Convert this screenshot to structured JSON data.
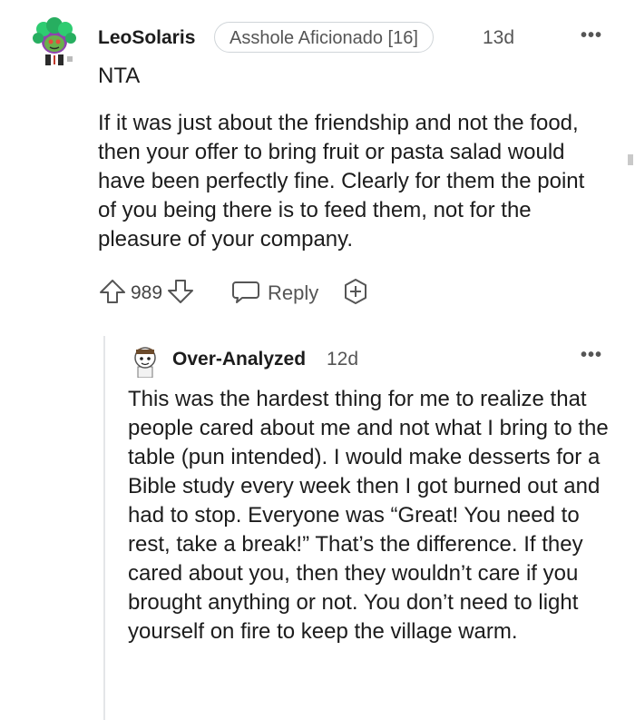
{
  "comment": {
    "author": "LeoSolaris",
    "flair": "Asshole Aficionado [16]",
    "age": "13d",
    "more": "•••",
    "verdict": "NTA",
    "body": "If it was just about the friendship and not the food, then your offer to bring fruit or pasta salad would have been perfectly fine. Clearly for them the point of you being there is to feed them, not for the pleasure of your company.",
    "score": "989",
    "reply_label": "Reply",
    "avatar_icon": "snoo-avatar-icon"
  },
  "reply": {
    "author": "Over-Analyzed",
    "age": "12d",
    "more": "•••",
    "body": "This was the hardest thing for me to realize that people cared about me and not what I bring to the table (pun intended). I would make desserts for a Bible study every week then I got burned out and had to stop. Everyone was “Great! You need to rest, take a break!” That’s the difference. If they cared about you, then they wouldn’t care if you brought anything or not. You don’t need to light yourself on fire to keep the village warm.",
    "avatar_icon": "snoo-avatar-icon"
  },
  "colors": {
    "text": "#1c1c1c",
    "muted": "#555555",
    "border": "#d0d5d9",
    "threadline": "#e4e6e8"
  }
}
